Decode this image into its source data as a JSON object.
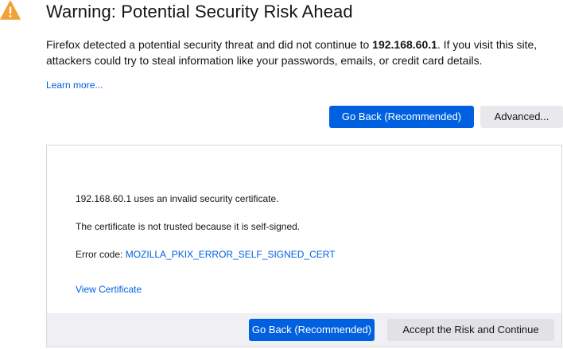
{
  "header": {
    "title": "Warning: Potential Security Risk Ahead",
    "icon": "warning-triangle-icon",
    "icon_color": "#f4a036"
  },
  "description": {
    "prefix": "Firefox detected a potential security threat and did not continue to ",
    "host": "192.168.60.1",
    "suffix": ". If you visit this site, attackers could try to steal information like your passwords, emails, or credit card details."
  },
  "learn_more": "Learn more...",
  "buttons": {
    "go_back": "Go Back (Recommended)",
    "advanced": "Advanced..."
  },
  "advanced_panel": {
    "line1": "192.168.60.1 uses an invalid security certificate.",
    "line2": "The certificate is not trusted because it is self-signed.",
    "error_code_label": "Error code: ",
    "error_code": "MOZILLA_PKIX_ERROR_SELF_SIGNED_CERT",
    "view_certificate": "View Certificate",
    "go_back": "Go Back (Recommended)",
    "accept": "Accept the Risk and Continue"
  },
  "colors": {
    "accent": "#0061e0",
    "warning": "#f4a036"
  }
}
